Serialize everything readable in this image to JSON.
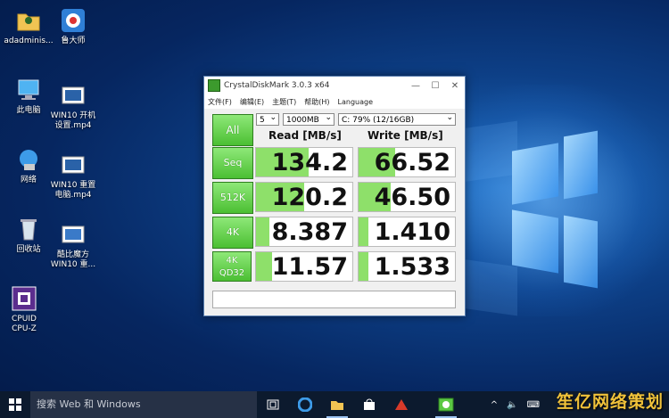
{
  "desktop": {
    "icons": [
      {
        "label": "adadminis..."
      },
      {
        "label": "鲁大师"
      },
      {
        "label": "此电脑"
      },
      {
        "label": "WIN10 开机\n设置.mp4"
      },
      {
        "label": "网络"
      },
      {
        "label": "WIN10 重置\n电脑.mp4"
      },
      {
        "label": "回收站"
      },
      {
        "label": "酷比魔方\nWIN10 重..."
      },
      {
        "label": "CPUID\nCPU-Z"
      }
    ]
  },
  "window": {
    "title": "CrystalDiskMark 3.0.3 x64",
    "controls": {
      "minimize": "—",
      "maximize": "☐",
      "close": "✕"
    },
    "menu": [
      "文件(F)",
      "编辑(E)",
      "主题(T)",
      "帮助(H)",
      "Language"
    ],
    "all_label": "All",
    "count_value": "5",
    "size_value": "1000MB",
    "drive_value": "C: 79% (12/16GB)",
    "read_header": "Read [MB/s]",
    "write_header": "Write [MB/s]",
    "rows": [
      {
        "label": "Seq",
        "read": "134.2",
        "write": "66.52",
        "read_fill": 0.55,
        "write_fill": 0.38
      },
      {
        "label": "512K",
        "read": "120.2",
        "write": "46.50",
        "read_fill": 0.5,
        "write_fill": 0.33
      },
      {
        "label": "4K",
        "read": "8.387",
        "write": "1.410",
        "read_fill": 0.14,
        "write_fill": 0.1
      },
      {
        "label": "4K\nQD32",
        "read": "11.57",
        "write": "1.533",
        "read_fill": 0.17,
        "write_fill": 0.1
      }
    ],
    "accent_green": "#4bbf33",
    "bar_green": "#8ee06a"
  },
  "taskbar": {
    "search_placeholder": "搜索 Web 和 Windows",
    "icons": [
      "task-view-icon",
      "edge-icon",
      "file-explorer-icon",
      "store-icon",
      "app-red-icon",
      "crystaldiskmark-icon"
    ],
    "tray": {
      "chevron": "^",
      "volume": "🔈",
      "keyboard": "⌨"
    }
  },
  "watermark": {
    "text": "笙亿网络策划"
  }
}
